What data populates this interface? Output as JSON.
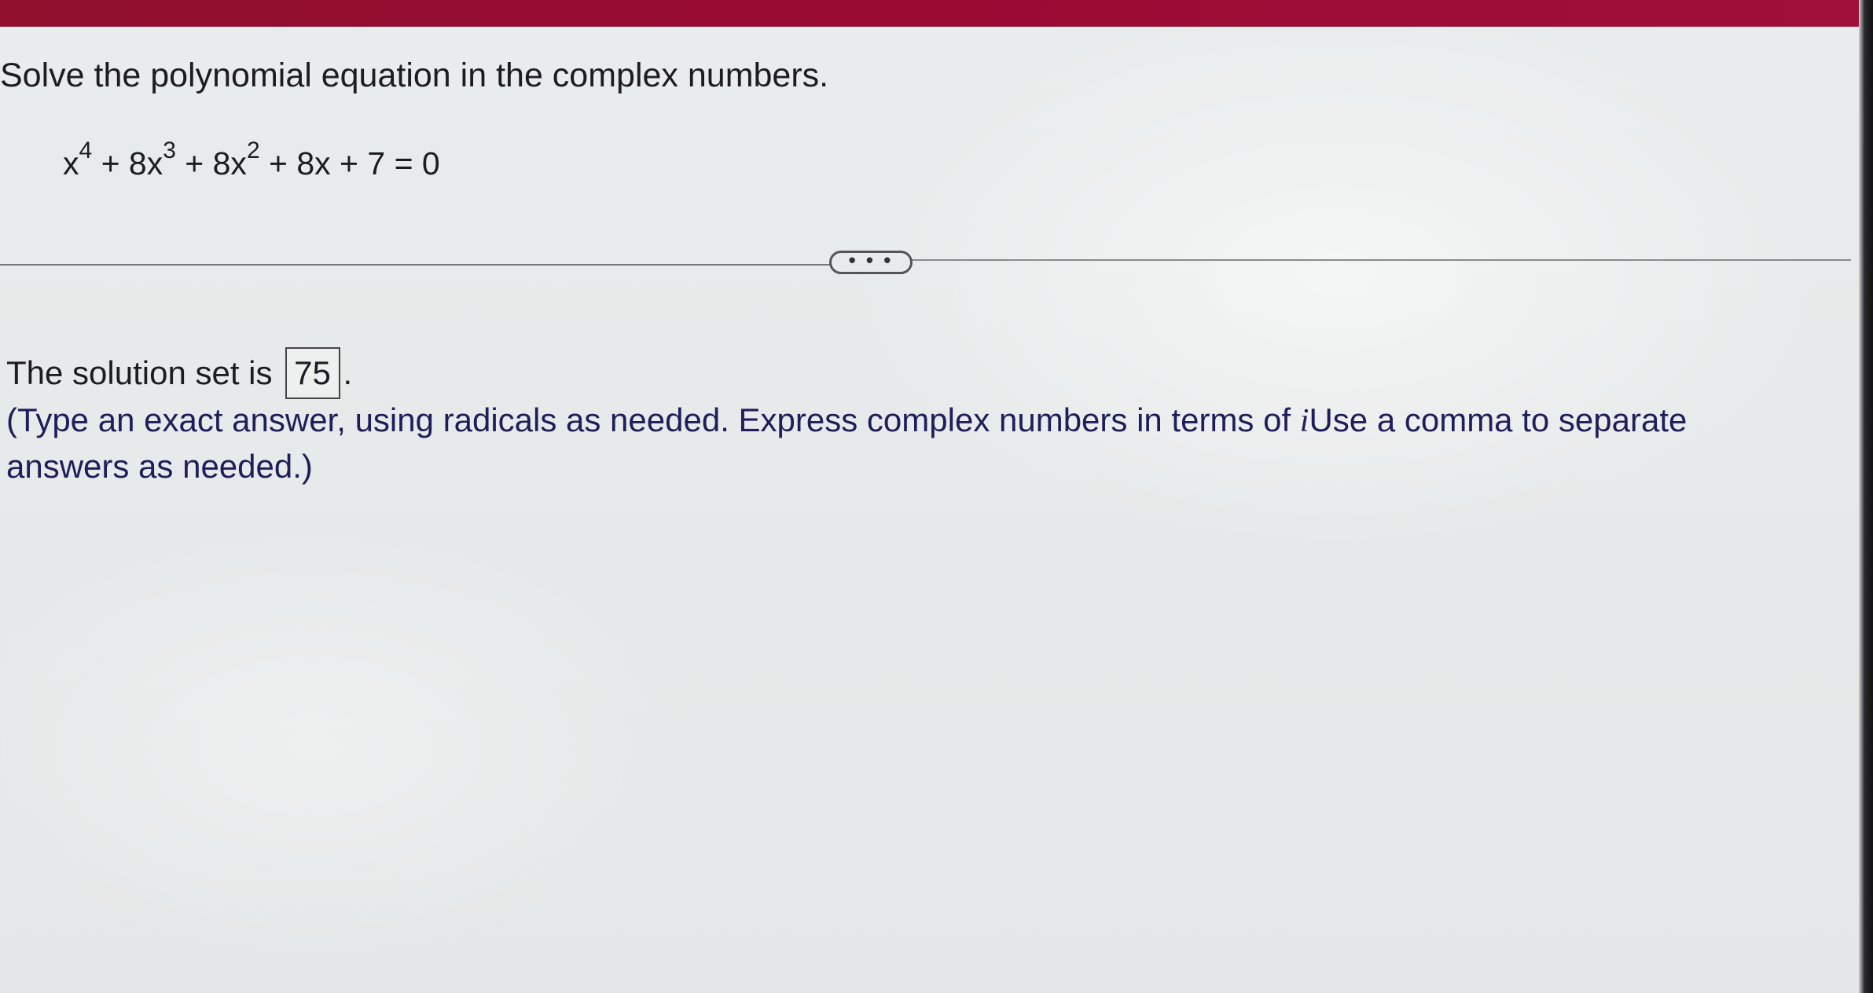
{
  "question": {
    "prompt": "Solve the polynomial equation in the complex numbers."
  },
  "equation": {
    "t1": "x",
    "e1": "4",
    "t2": " + 8x",
    "e2": "3",
    "t3": " + 8x",
    "e3": "2",
    "t4": " + 8x + 7 = 0"
  },
  "more_button": {
    "label": "• • •"
  },
  "answer": {
    "prefix": "The solution set is",
    "value": "75",
    "suffix": "."
  },
  "instructions": {
    "line1_part1": "(Type an exact answer, using radicals as needed. Express complex numbers in terms of ",
    "italic_i": "i",
    "line1_part2": "Use a comma to separate",
    "line2": "answers as needed.)"
  },
  "colors": {
    "top_bar": "#9a0a33",
    "background": "#e7eaea",
    "instruction_text": "#1e1e5a"
  }
}
